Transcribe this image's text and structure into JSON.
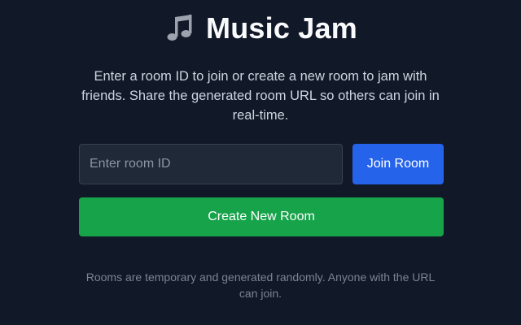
{
  "header": {
    "icon": "music-note-icon",
    "title": "Music Jam"
  },
  "intro": {
    "text": "Enter a room ID to join or create a new room to jam with friends. Share the generated room URL so others can join in real-time."
  },
  "join_form": {
    "room_id_value": "",
    "room_id_placeholder": "Enter room ID",
    "join_label": "Join Room"
  },
  "create": {
    "label": "Create New Room"
  },
  "footer": {
    "text": "Rooms are temporary and generated randomly. Anyone with the URL can join."
  },
  "colors": {
    "background": "#111827",
    "join_button": "#2563eb",
    "create_button": "#16a34a",
    "input_background": "#1f2937",
    "icon": "#9ca3af"
  }
}
